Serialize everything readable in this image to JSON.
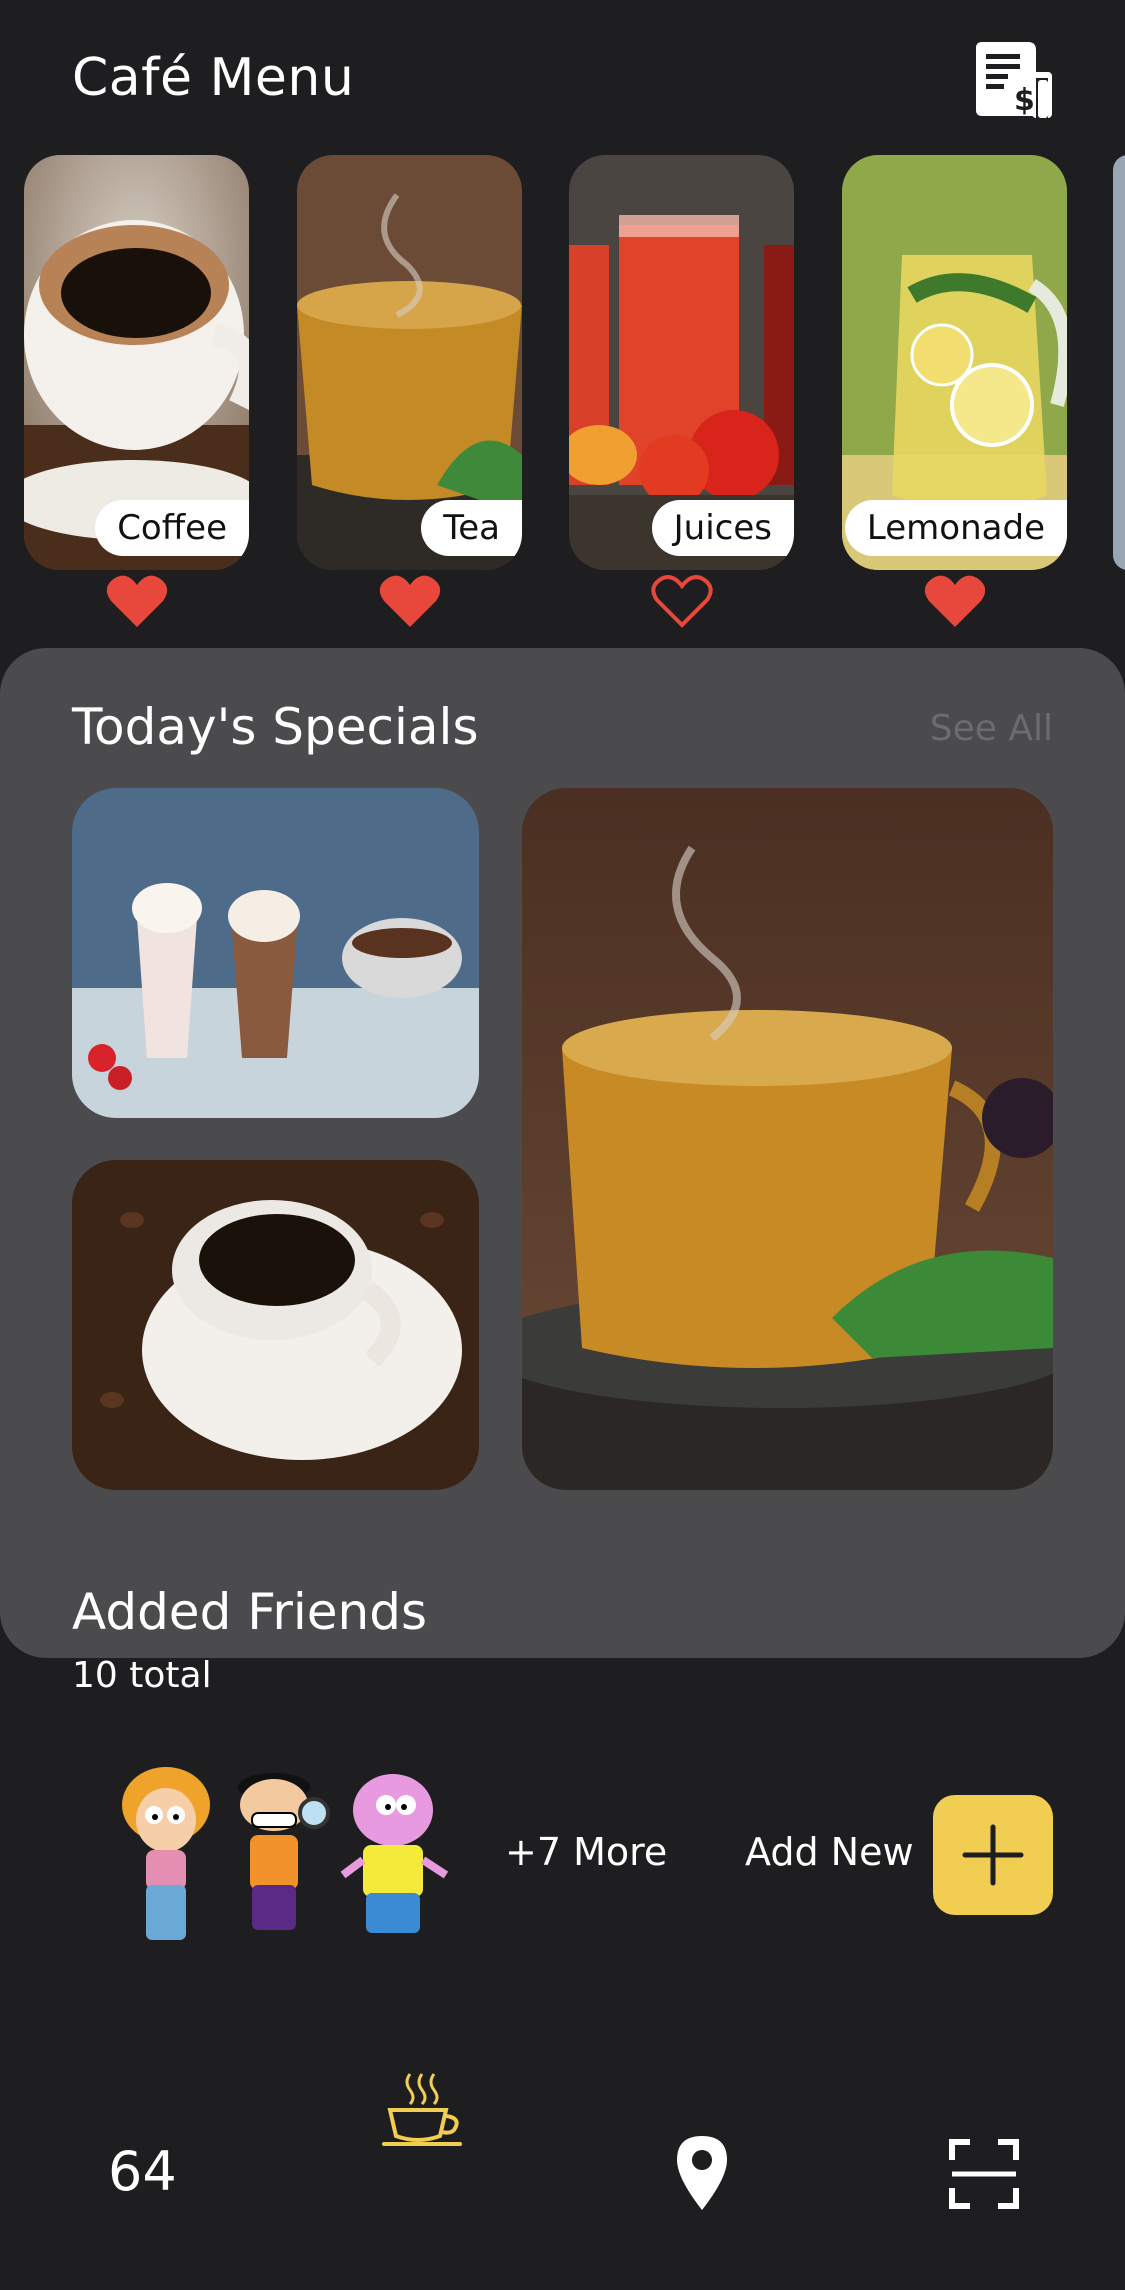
{
  "header": {
    "title": "Café Menu",
    "bill_icon": "bill-dollar-icon"
  },
  "categories": [
    {
      "label": "Coffee",
      "favorited": true
    },
    {
      "label": "Tea",
      "favorited": true
    },
    {
      "label": "Juices",
      "favorited": false
    },
    {
      "label": "Lemonade",
      "favorited": true
    }
  ],
  "specials": {
    "title": "Today's Specials",
    "see_all": "See All"
  },
  "friends": {
    "title": "Added Friends",
    "total": "10 total",
    "more": "+7 More",
    "add_new": "Add New"
  },
  "nav": {
    "counter": "64",
    "icons": [
      "coffee-cup-icon",
      "location-pin-icon",
      "scan-icon"
    ]
  },
  "colors": {
    "background": "#1e1d1f",
    "panel": "#4b4a4c",
    "accent": "#f1cd52",
    "heart": "#e8473b",
    "nav_active": "#f1cd52"
  }
}
